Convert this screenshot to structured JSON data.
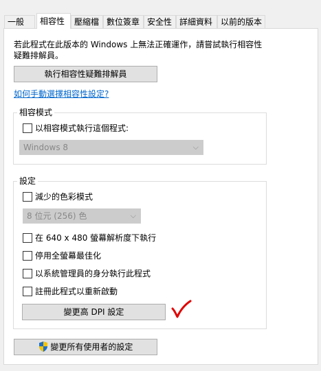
{
  "tabs": [
    "一般",
    "相容性",
    "壓縮檔",
    "數位簽章",
    "安全性",
    "詳細資料",
    "以前的版本"
  ],
  "intro_text_line1": "若此程式在此版本的 Windows 上無法正確運作，請嘗試執行相容性",
  "intro_text_line2": "疑難排解員。",
  "troubleshoot_button": "執行相容性疑難排解員",
  "manual_link": "如何手動選擇相容性設定?",
  "compat_mode": {
    "legend": "相容模式",
    "checkbox_label": "以相容模式執行這個程式:",
    "os_select": "Windows 8"
  },
  "settings": {
    "legend": "設定",
    "reduced_color": "減少的色彩模式",
    "color_select": "8 位元 (256) 色",
    "resolution_640": "在 640 x 480 螢幕解析度下執行",
    "disable_fullscreen_opt": "停用全螢幕最佳化",
    "run_as_admin": "以系統管理員的身分執行此程式",
    "register_restart": "註冊此程式以重新啟動",
    "dpi_button": "變更高 DPI 設定"
  },
  "all_users_button": "變更所有使用者的設定",
  "icons": {
    "shield": "uac-shield-icon",
    "annotation": "red-checkmark-icon",
    "dropdown": "chevron-down-icon"
  },
  "colors": {
    "link": "#0066cc",
    "annotation": "#e00000"
  }
}
